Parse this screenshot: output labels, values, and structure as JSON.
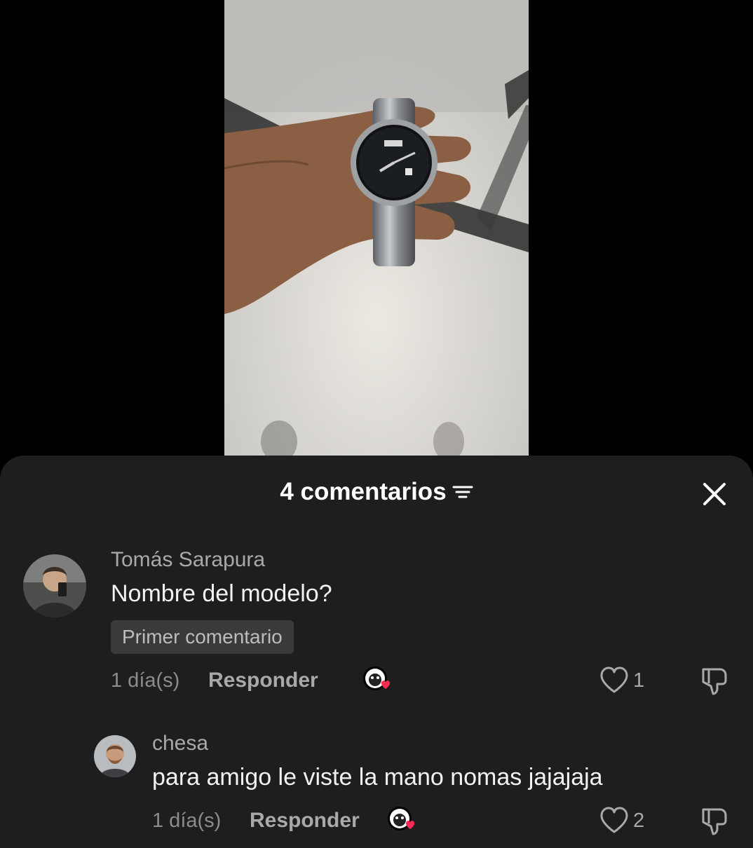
{
  "header": {
    "title": "4 comentarios",
    "sort_icon": "sort-filter-icon",
    "close_icon": "close-icon"
  },
  "comments": [
    {
      "username": "Tomás Sarapura",
      "text": "Nombre del modelo?",
      "badge": "Primer comentario",
      "time": "1 día(s)",
      "reply_label": "Responder",
      "likes": "1"
    },
    {
      "username": "chesa",
      "text": "para amigo le viste la mano nomas jajajaja",
      "time": "1 día(s)",
      "reply_label": "Responder",
      "likes": "2"
    }
  ],
  "colors": {
    "sheet_bg": "#1e1e1e",
    "creator_heart": "#fe2c55"
  }
}
